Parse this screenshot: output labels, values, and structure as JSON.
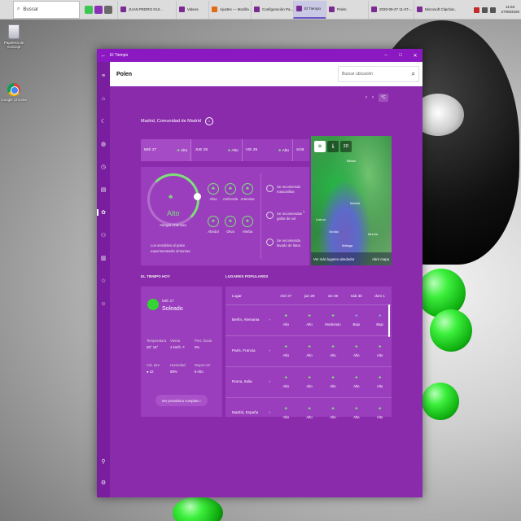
{
  "taskbar": {
    "search_placeholder": "Buscar",
    "apps": [
      {
        "label": "JUAN PEDRO GUI...",
        "color": "#7a2b93"
      },
      {
        "label": "Videos",
        "color": "#7a2b93"
      },
      {
        "label": "Ajustes — Mozilla ...",
        "color": "#e06a16"
      },
      {
        "label": "Configuración Pa...",
        "color": "#7a2b93"
      },
      {
        "label": "El Tiempo",
        "color": "#7a2b93",
        "active": true
      },
      {
        "label": "Polen",
        "color": "#7a2b93"
      },
      {
        "label": "2020-09-27 11-07-...",
        "color": "#7a2b93"
      },
      {
        "label": "Microsoft Clipchar...",
        "color": "#7a2b93"
      }
    ],
    "time": "11:50",
    "date": "27/09/2020"
  },
  "desktop": {
    "recycle_label": "Papelera de reciclaje",
    "chrome_label": "Google Chrome"
  },
  "window": {
    "title": "El Tiempo",
    "controls": [
      "–",
      "□",
      "✕"
    ]
  },
  "topbar": {
    "page_title": "Polen",
    "search_placeholder": "Buscar ubicación"
  },
  "unit_button": "°C",
  "location": "Madrid, Comunidad de Madrid",
  "days": [
    {
      "label": "MIÉ 27",
      "level": "Alto"
    },
    {
      "label": "JUE 28",
      "level": "Alto"
    },
    {
      "label": "VIE 29",
      "level": "Alto"
    },
    {
      "label": "SÁB",
      "level": ""
    }
  ],
  "gauge": {
    "level": "Alto",
    "subtitle": "Alergia Artemisa",
    "note": "Los sensibles al polen experimentarán síntomas"
  },
  "pollen_types": [
    {
      "label": "Aliso",
      "moderate": false
    },
    {
      "label": "Ambrosía",
      "moderate": false
    },
    {
      "label": "Artemisa",
      "moderate": false
    },
    {
      "label": "Abedul",
      "moderate": false
    },
    {
      "label": "Oliva",
      "moderate": false
    },
    {
      "label": "Hierba",
      "moderate": false
    }
  ],
  "recommendations": [
    "Se recomienda mascarillas",
    "Se recomiendan gafas de sol",
    "Se recomienda lavado de llana"
  ],
  "map": {
    "tabs": [
      "✿",
      "🌡",
      "3D"
    ],
    "labels": [
      "Madrid",
      "Sevilla",
      "Murcia",
      "Málaga",
      "Bilbao",
      "Lisboa"
    ],
    "footer_left": "Ver más lugares alrededor",
    "footer_right": "Abrir mapa"
  },
  "today": {
    "section_title": "EL TIEMPO HOY",
    "date": "MIÉ 27",
    "condition": "Soleado",
    "stats": [
      {
        "key": "Temperatura",
        "value": "28° 16°"
      },
      {
        "key": "Viento",
        "value": "4 km/h ↗"
      },
      {
        "key": "Prec. lluvia",
        "value": "0%"
      },
      {
        "key": "Cal. aire",
        "value": "● 42"
      },
      {
        "key": "Humedad",
        "value": "58%"
      },
      {
        "key": "Rayos UV",
        "value": "6 Alto"
      }
    ],
    "forecast_button": "Ver pronóstico completo  ›"
  },
  "popular": {
    "section_title": "LUGARES POPULARES",
    "headers": [
      "Lugar",
      "mié 27",
      "jue 28",
      "vie 29",
      "sáb 30",
      "dom 1"
    ],
    "rows": [
      {
        "city": "Berlín, Alemania",
        "cells": [
          "Alto",
          "Alto",
          "Moderado",
          "Bajo",
          "Bajo"
        ]
      },
      {
        "city": "París, Francia",
        "cells": [
          "Alto",
          "Alto",
          "Alto",
          "Alto",
          "Alto"
        ]
      },
      {
        "city": "Roma, Italia",
        "cells": [
          "Alto",
          "Alto",
          "Alto",
          "Alto",
          "Alto"
        ]
      },
      {
        "city": "Madrid, España",
        "cells": [
          "Alto",
          "Alto",
          "Alto",
          "Alto",
          "Alto"
        ]
      }
    ]
  }
}
